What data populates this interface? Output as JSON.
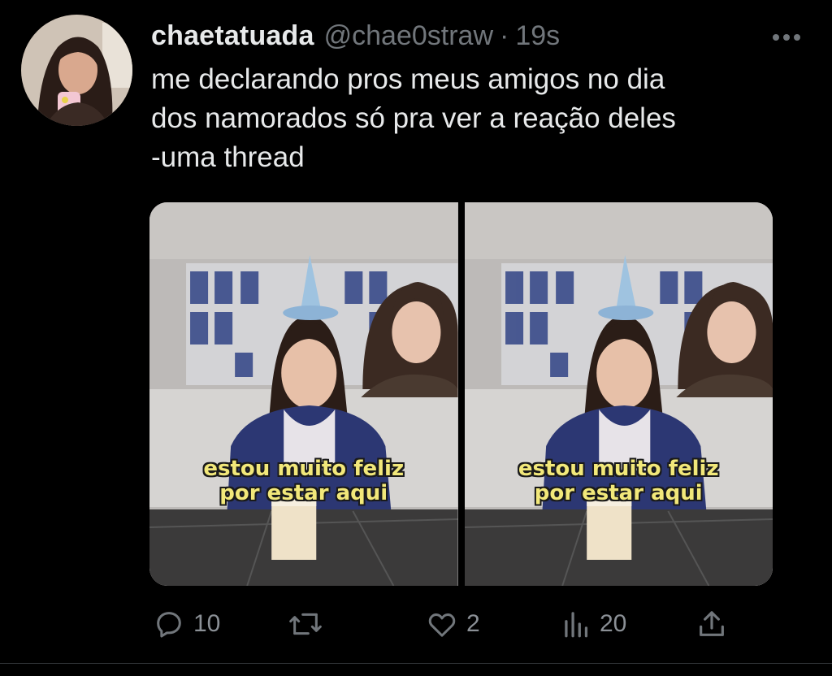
{
  "tweet": {
    "display_name": "chaetatuada",
    "handle": "@chae0straw",
    "separator": "·",
    "time": "19s",
    "text": "me declarando pros meus amigos no dia\ndos namorados só pra ver a reação deles\n-uma thread"
  },
  "media": [
    {
      "caption": "estou muito feliz\npor estar aqui"
    },
    {
      "caption": "estou muito feliz\npor estar aqui"
    }
  ],
  "actions": {
    "reply_count": "10",
    "retweet_count": "",
    "like_count": "2",
    "views_count": "20"
  },
  "colors": {
    "background": "#000000",
    "text": "#e7e9ea",
    "secondary": "#71767b",
    "caption": "#f2e87a"
  },
  "icons": [
    "more-icon",
    "reply-icon",
    "retweet-icon",
    "like-icon",
    "views-icon",
    "share-icon"
  ]
}
